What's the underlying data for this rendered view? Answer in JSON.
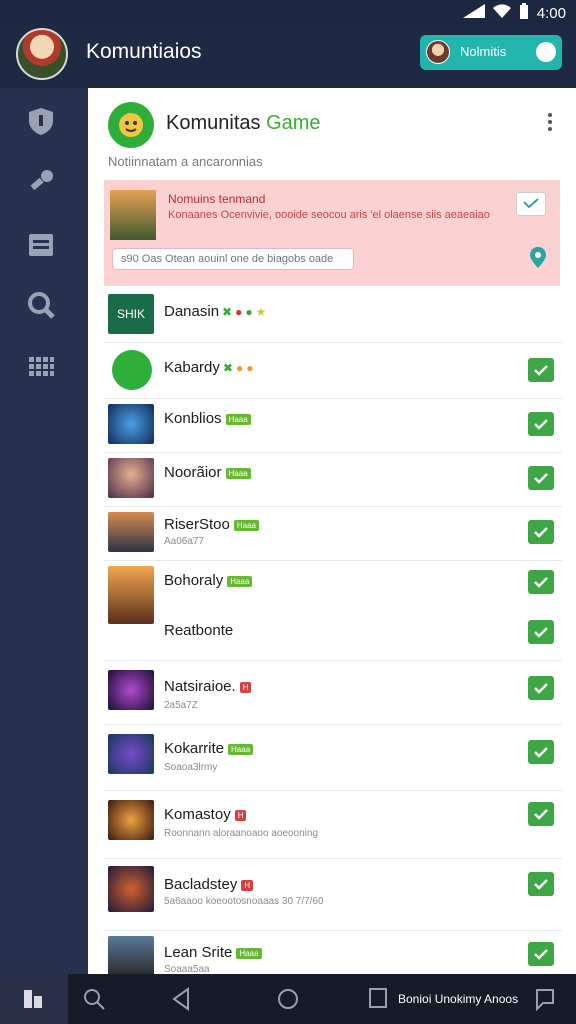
{
  "status": {
    "time": "4:00"
  },
  "topbar": {
    "title": "Komuntiaios",
    "notif_label": "Nolmitis"
  },
  "header": {
    "title_main": "Komunitas",
    "title_accent": "Game",
    "subtitle": "Notiinnatam a ancaronnias"
  },
  "notice": {
    "title": "Nomuins tenmand",
    "body": "Konaanes Ocenvivie, oooide seocou aris 'el olaense siis aeaeaiao",
    "input_placeholder": "s90 Oas Otean aouinl one de biagobs oade"
  },
  "rows": [
    {
      "title": "Danasin",
      "sub": "",
      "checked": false
    },
    {
      "title": "Kabardy",
      "sub": "",
      "checked": true
    },
    {
      "title": "Konblios",
      "sub": "",
      "badge": "green",
      "checked": true
    },
    {
      "title": "Noorãior",
      "sub": "",
      "badge": "green",
      "checked": true
    },
    {
      "title": "RiserStoo",
      "sub": "Aa06a77",
      "badge": "green",
      "checked": true
    },
    {
      "title": "Bohoraly",
      "sub": "",
      "badge": "green",
      "checked": true
    },
    {
      "title": "Reatbonte",
      "sub": "",
      "checked": true
    },
    {
      "title": "Natsiraioe.",
      "sub": "2a5a7Z",
      "badge": "red",
      "checked": true
    },
    {
      "title": "Kokarrite",
      "sub": "Soaoa3lrmy",
      "badge": "green",
      "checked": true
    },
    {
      "title": "Komastoy",
      "sub": "Roonnann aloraanoaoo aoeooning",
      "badge": "red",
      "checked": true
    },
    {
      "title": "Bacladstey",
      "sub": "5a6aaoo  koeootosnoaaas 30  7/7/60",
      "badge": "red",
      "checked": true
    },
    {
      "title": "Lean Srite",
      "sub": "Soaaa5aa",
      "badge": "green",
      "checked": true
    }
  ],
  "badges": {
    "green": "Haaa",
    "red": "H"
  },
  "thumbs": {
    "dansin": "SHIK"
  },
  "navbar": {
    "label": "Bonioi Unokimy Anoos"
  }
}
